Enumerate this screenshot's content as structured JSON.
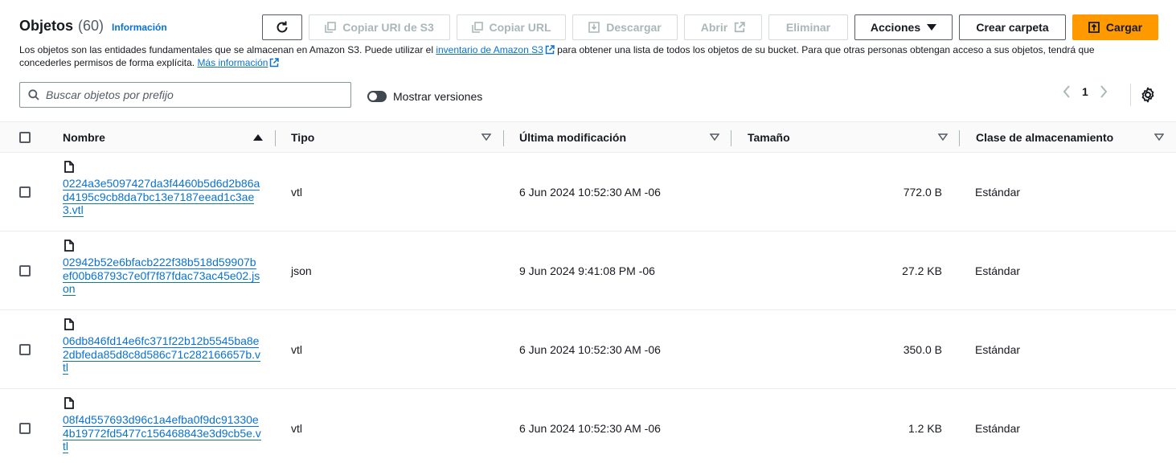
{
  "header": {
    "title": "Objetos",
    "count": "(60)",
    "info_link": "Información",
    "description_part1": "Los objetos son las entidades fundamentales que se almacenan en Amazon S3. Puede utilizar el ",
    "inventory_link": "inventario de Amazon S3",
    "description_part2": " para obtener una lista de todos los objetos de su bucket. Para que otras personas obtengan acceso a sus objetos, tendrá que concederles permisos de forma explícita. ",
    "more_info_link": "Más información"
  },
  "toolbar": {
    "refresh_icon": "refresh-icon",
    "copy_s3_uri": "Copiar URI de S3",
    "copy_url": "Copiar URL",
    "download": "Descargar",
    "open": "Abrir",
    "delete": "Eliminar",
    "actions": "Acciones",
    "create_folder": "Crear carpeta",
    "upload": "Cargar"
  },
  "search": {
    "placeholder": "Buscar objetos por prefijo",
    "value": ""
  },
  "versions_toggle": {
    "label": "Mostrar versiones",
    "on": false
  },
  "pagination": {
    "current_page": "1"
  },
  "table": {
    "columns": [
      "Nombre",
      "Tipo",
      "Última modificación",
      "Tamaño",
      "Clase de almacenamiento"
    ],
    "rows": [
      {
        "name": "0224a3e5097427da3f4460b5d6d2b86ad4195c9cb8da7bc13e7187eead1c3ae3.vtl",
        "type": "vtl",
        "modified": "6 Jun 2024 10:52:30 AM -06",
        "size": "772.0 B",
        "storage": "Estándar"
      },
      {
        "name": "02942b52e6bfacb222f38b518d59907bef00b68793c7e0f7f87fdac73ac45e02.json",
        "type": "json",
        "modified": "9 Jun 2024 9:41:08 PM -06",
        "size": "27.2 KB",
        "storage": "Estándar"
      },
      {
        "name": "06db846fd14e6fc371f22b12b5545ba8e2dbfeda85d8c8d586c71c282166657b.vtl",
        "type": "vtl",
        "modified": "6 Jun 2024 10:52:30 AM -06",
        "size": "350.0 B",
        "storage": "Estándar"
      },
      {
        "name": "08f4d557693d96c1a4efba0f9dc91330e4b19772fd5477c156468843e3d9cb5e.vtl",
        "type": "vtl",
        "modified": "6 Jun 2024 10:52:30 AM -06",
        "size": "1.2 KB",
        "storage": "Estándar"
      }
    ]
  },
  "colors": {
    "primary": "#ff9900",
    "link": "#0972d3",
    "text": "#16191f",
    "disabled": "#aab7b8"
  }
}
